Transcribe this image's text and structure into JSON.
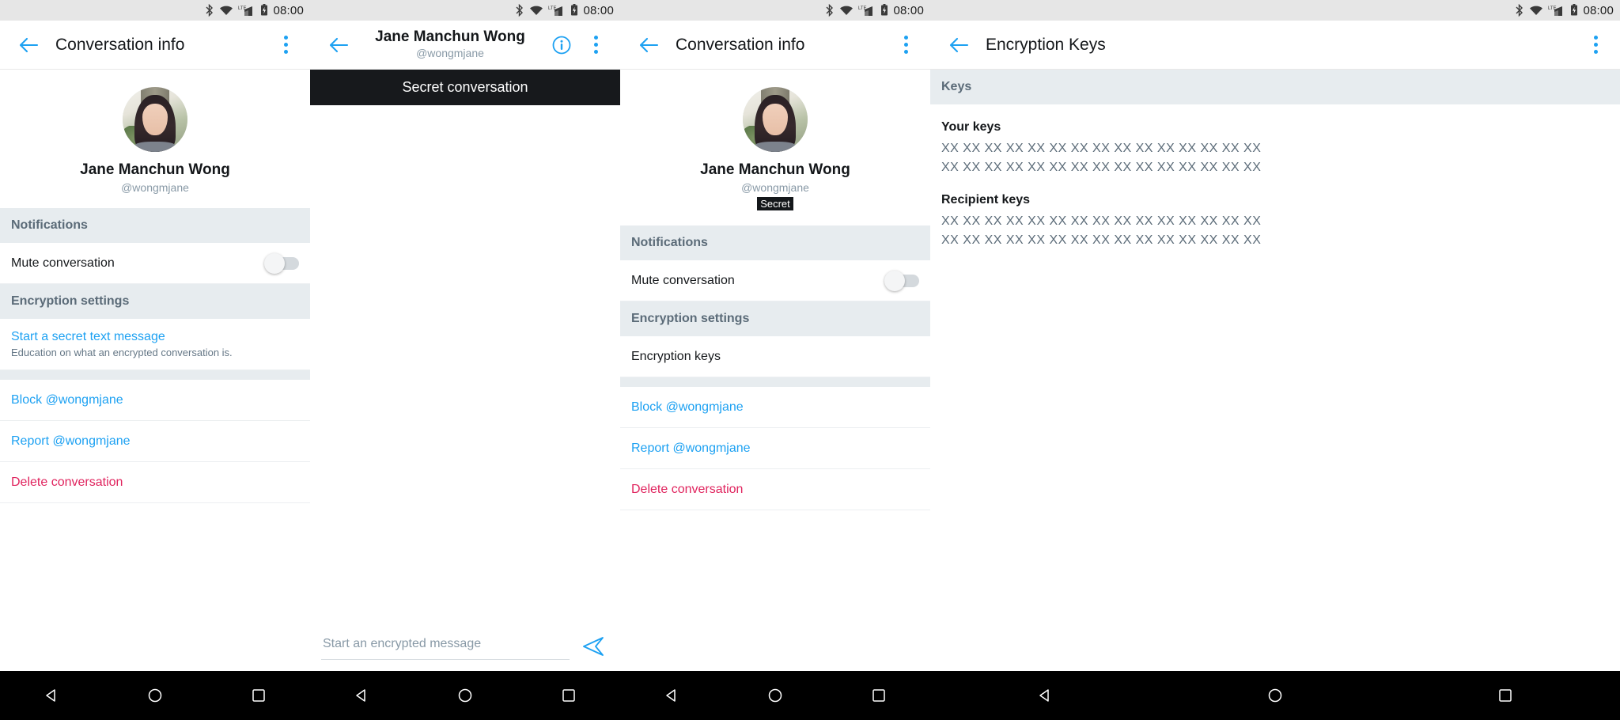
{
  "status_bar": {
    "time": "08:00",
    "icons": [
      "bluetooth-icon",
      "wifi-icon",
      "lte-signal-icon",
      "battery-charging-icon"
    ]
  },
  "panels": [
    {
      "id": "conversation-info",
      "appbar": {
        "title": "Conversation info",
        "back_icon": "back-arrow-icon",
        "overflow_icon": "overflow-menu-icon"
      },
      "profile": {
        "name": "Jane Manchun Wong",
        "handle": "@wongmjane"
      },
      "sections": {
        "notifications_header": "Notifications",
        "mute_label": "Mute conversation",
        "encryption_header": "Encryption settings",
        "secret_link": "Start a secret text message",
        "secret_sub": "Education on what an encrypted conversation is.",
        "block": "Block @wongmjane",
        "report": "Report @wongmjane",
        "delete": "Delete conversation"
      }
    },
    {
      "id": "secret-chat",
      "appbar": {
        "name": "Jane Manchun Wong",
        "handle": "@wongmjane",
        "back_icon": "back-arrow-icon",
        "info_icon": "info-circle-icon",
        "overflow_icon": "overflow-menu-icon"
      },
      "banner": "Secret conversation",
      "composer": {
        "placeholder": "Start an encrypted message",
        "value": "",
        "send_icon": "send-icon"
      }
    },
    {
      "id": "conversation-info-secret",
      "appbar": {
        "title": "Conversation info",
        "back_icon": "back-arrow-icon",
        "overflow_icon": "overflow-menu-icon"
      },
      "profile": {
        "name": "Jane Manchun Wong",
        "handle": "@wongmjane",
        "badge": "Secret"
      },
      "sections": {
        "notifications_header": "Notifications",
        "mute_label": "Mute conversation",
        "encryption_header": "Encryption settings",
        "encryption_keys": "Encryption keys",
        "block": "Block @wongmjane",
        "report": "Report @wongmjane",
        "delete": "Delete conversation"
      }
    },
    {
      "id": "encryption-keys",
      "appbar": {
        "title": "Encryption Keys",
        "back_icon": "back-arrow-icon",
        "overflow_icon": "overflow-menu-icon"
      },
      "keys_header": "Keys",
      "your_keys_title": "Your keys",
      "your_keys_lines": [
        "XX XX XX XX XX XX XX XX XX XX XX XX XX XX XX",
        "XX XX XX XX XX XX XX XX XX XX XX XX XX XX XX"
      ],
      "recipient_keys_title": "Recipient keys",
      "recipient_keys_lines": [
        "XX XX XX XX XX XX XX XX XX XX XX XX XX XX XX",
        "XX XX XX XX XX XX XX XX XX XX XX XX XX XX XX"
      ]
    }
  ],
  "nav_bar": {
    "back_icon": "nav-back-triangle-icon",
    "home_icon": "nav-home-circle-icon",
    "recents_icon": "nav-recents-square-icon"
  },
  "colors": {
    "accent": "#1da1f2",
    "danger": "#e0245e",
    "section_bg": "#e7ecef",
    "section_text": "#5b6b78",
    "banner_bg": "#17191c"
  }
}
